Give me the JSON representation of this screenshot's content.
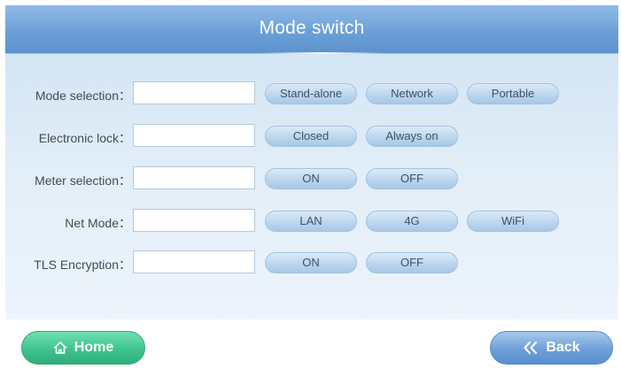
{
  "header": {
    "title": "Mode switch"
  },
  "rows": [
    {
      "label": "Mode selection：",
      "value": "",
      "options": [
        "Stand-alone",
        "Network",
        "Portable"
      ]
    },
    {
      "label": "Electronic lock：",
      "value": "",
      "options": [
        "Closed",
        "Always on"
      ]
    },
    {
      "label": "Meter selection：",
      "value": "",
      "options": [
        "ON",
        "OFF"
      ]
    },
    {
      "label": "Net Mode：",
      "value": "",
      "options": [
        "LAN",
        "4G",
        "WiFi"
      ]
    },
    {
      "label": "TLS Encryption：",
      "value": "",
      "options": [
        "ON",
        "OFF"
      ]
    }
  ],
  "footer": {
    "home_label": "Home",
    "back_label": "Back",
    "home_icon": "home-icon",
    "back_icon": "double-chevron-left-icon"
  },
  "colors": {
    "header": "#6c9fd7",
    "panel": "#e2eef8",
    "home_button": "#3fc38e",
    "back_button": "#6e9fd8"
  }
}
